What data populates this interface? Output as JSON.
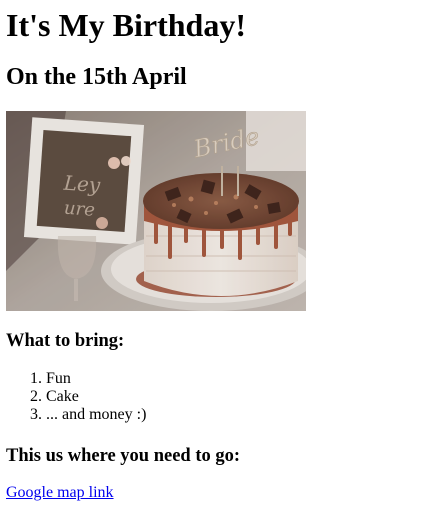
{
  "header": {
    "title": "It's My Birthday!",
    "subtitle": "On the 15th April"
  },
  "image": {
    "alt": "Birthday cake",
    "topper_text": "Bride"
  },
  "bring_section": {
    "heading": "What to bring:",
    "items": [
      "Fun",
      "Cake",
      "... and money :)"
    ]
  },
  "location_section": {
    "heading": "This us where you need to go:",
    "link_text": "Google map link"
  },
  "colors": {
    "link": "#0000ee",
    "text": "#000000",
    "background": "#ffffff"
  }
}
